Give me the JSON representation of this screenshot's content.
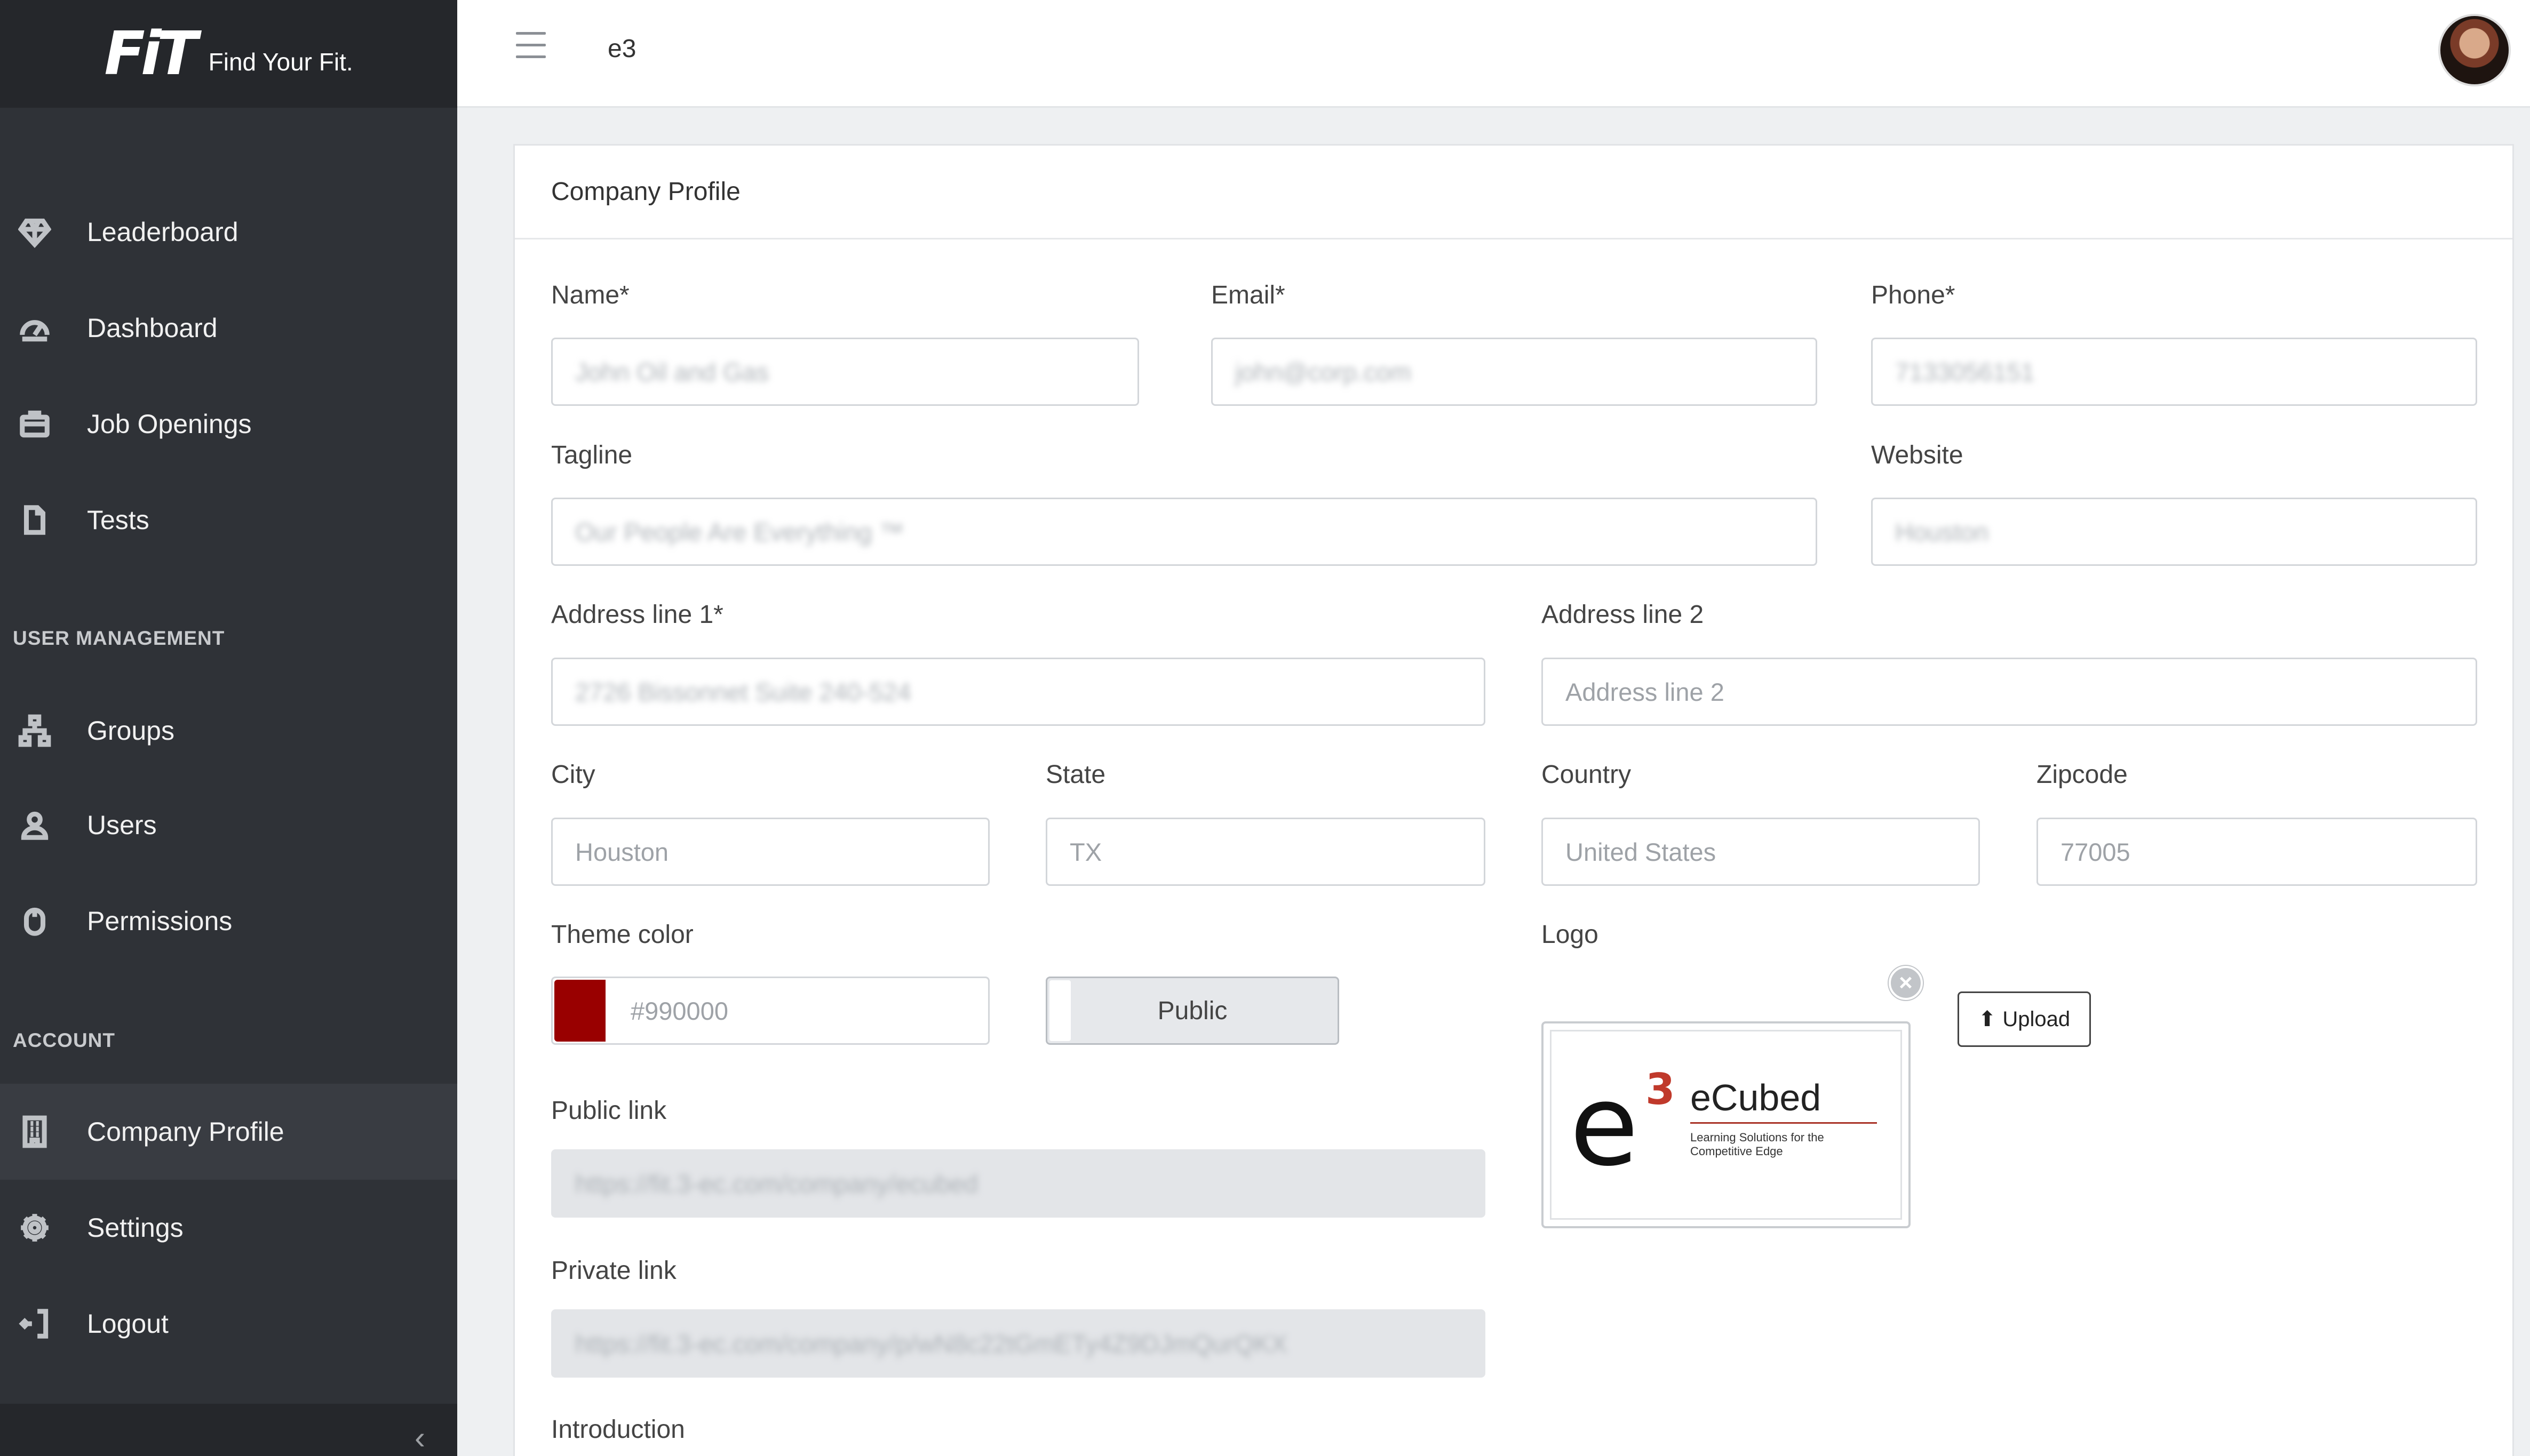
{
  "brand": {
    "mark": "FiT",
    "tagline": "Find Your Fit."
  },
  "topbar": {
    "title": "e3"
  },
  "sidebar": {
    "items": [
      {
        "label": "Leaderboard",
        "icon": "diamond-icon"
      },
      {
        "label": "Dashboard",
        "icon": "speedometer-icon"
      },
      {
        "label": "Job Openings",
        "icon": "briefcase-icon"
      },
      {
        "label": "Tests",
        "icon": "document-icon"
      }
    ],
    "user_management_heading": "USER MANAGEMENT",
    "user_items": [
      {
        "label": "Groups",
        "icon": "hierarchy-icon"
      },
      {
        "label": "Users",
        "icon": "user-icon"
      },
      {
        "label": "Permissions",
        "icon": "mouse-icon"
      }
    ],
    "account_heading": "ACCOUNT",
    "account_items": [
      {
        "label": "Company Profile",
        "icon": "building-icon",
        "active": true
      },
      {
        "label": "Settings",
        "icon": "gear-icon"
      },
      {
        "label": "Logout",
        "icon": "logout-icon"
      }
    ]
  },
  "form": {
    "title": "Company Profile",
    "name": {
      "label": "Name*",
      "value": "John Oil and Gas"
    },
    "email": {
      "label": "Email*",
      "value": "john@corp.com"
    },
    "phone": {
      "label": "Phone*",
      "value": "7133056151"
    },
    "tagline": {
      "label": "Tagline",
      "value": "Our People Are Everything ™"
    },
    "website": {
      "label": "Website",
      "value": "Houston"
    },
    "address1": {
      "label": "Address line 1*",
      "value": "2726 Bissonnet Suite 240-524"
    },
    "address2": {
      "label": "Address line 2",
      "placeholder": "Address line 2"
    },
    "city": {
      "label": "City",
      "value": "Houston"
    },
    "state": {
      "label": "State",
      "value": "TX"
    },
    "country": {
      "label": "Country",
      "value": "United States"
    },
    "zipcode": {
      "label": "Zipcode",
      "value": "77005"
    },
    "theme_color": {
      "label": "Theme color",
      "value": "#990000",
      "swatch": "#990000"
    },
    "visibility": {
      "label": "Public"
    },
    "logo": {
      "label": "Logo",
      "brand": "eCubed",
      "superscript": "3",
      "letter": "e",
      "tagline": "Learning Solutions for the Competitive Edge",
      "remove": "×",
      "upload_label": "Upload"
    },
    "public_link": {
      "label": "Public link",
      "value": "https://fit.3-ec.com/company/ecubed"
    },
    "private_link": {
      "label": "Private link",
      "value": "https://fit.3-ec.com/company/p/wN8c22tGmETy4Z9DJmQurQKX"
    },
    "introduction": {
      "label": "Introduction"
    }
  }
}
